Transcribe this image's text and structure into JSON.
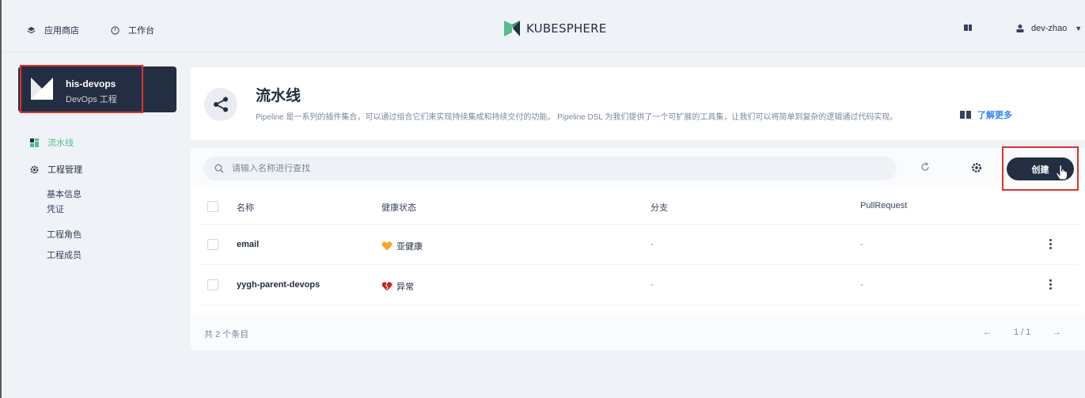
{
  "topbar": {
    "app_store": "应用商店",
    "workbench": "工作台",
    "brand": "KUBESPHERE",
    "username": "dev-zhao"
  },
  "project": {
    "name": "his-devops",
    "subtitle": "DevOps 工程"
  },
  "sidebar": {
    "pipelines": "流水线",
    "project_management": "工程管理",
    "sub_items": [
      "基本信息",
      "凭证",
      "工程角色",
      "工程成员"
    ]
  },
  "banner": {
    "title": "流水线",
    "description": "Pipeline 是一系列的插件集合，可以通过组合它们来实现持续集成和持续交付的功能。 Pipeline DSL 为我们提供了一个可扩展的工具集，让我们可以将简单到复杂的逻辑通过代码实现。",
    "learn_more": "了解更多"
  },
  "toolbar": {
    "search_placeholder": "请输入名称进行查找",
    "create_label": "创建"
  },
  "table": {
    "headers": [
      "名称",
      "健康状态",
      "分支",
      "PullRequest"
    ],
    "rows": [
      {
        "name": "email",
        "health": "亚健康",
        "health_color": "#f5a623",
        "branch": "-",
        "pr": "-"
      },
      {
        "name": "yygh-parent-devops",
        "health": "异常",
        "health_color": "#ca2621",
        "branch": "-",
        "pr": "-"
      }
    ]
  },
  "footer": {
    "total": "共 2 个条目",
    "prev": "←",
    "page": "1 / 1",
    "next": "→"
  },
  "colors": {
    "accent_green": "#55bc8a",
    "dark": "#242e42",
    "highlight_red": "#e0302f",
    "link_blue": "#3385ff"
  }
}
